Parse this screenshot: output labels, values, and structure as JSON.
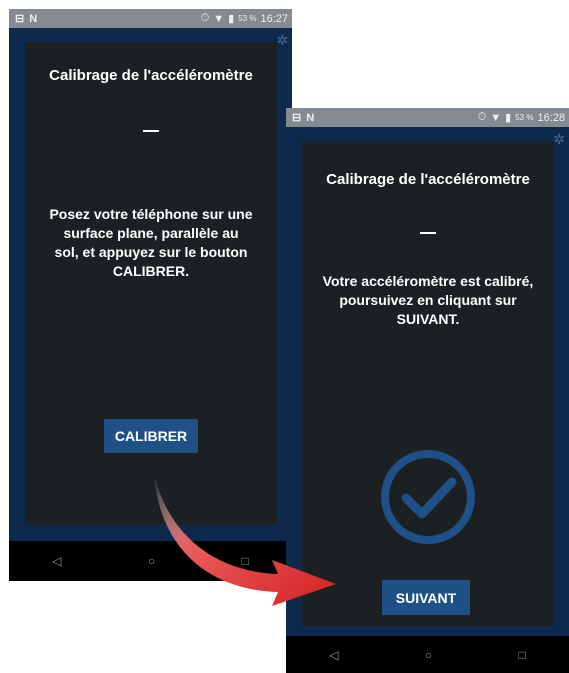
{
  "screen_left": {
    "status": {
      "left_icons": "⊟ N",
      "battery": "53 %",
      "time": "16:27"
    },
    "title": "Calibrage de l'accéléromètre",
    "message_lines": [
      "Posez votre téléphone sur une",
      "surface plane, parallèle au",
      "sol, et appuyez sur le bouton",
      "CALIBRER."
    ],
    "button_label": "CALIBRER",
    "nav": {
      "back": "◁",
      "home": "○",
      "recent": "□"
    }
  },
  "screen_right": {
    "status": {
      "left_icons": "⊟ N",
      "battery": "53 %",
      "time": "16:28"
    },
    "title": "Calibrage de l'accéléromètre",
    "message_lines": [
      "Votre accéléromètre est calibré,",
      "poursuivez en cliquant sur",
      "SUIVANT."
    ],
    "button_label": "SUIVANT",
    "nav": {
      "back": "◁",
      "home": "○",
      "recent": "□"
    }
  },
  "colors": {
    "phone_background": "#0d2a4e",
    "dialog_background": "#1d2023",
    "button": "#1f5088",
    "check_ring": "#1f5088",
    "arrow": "#d42020"
  }
}
